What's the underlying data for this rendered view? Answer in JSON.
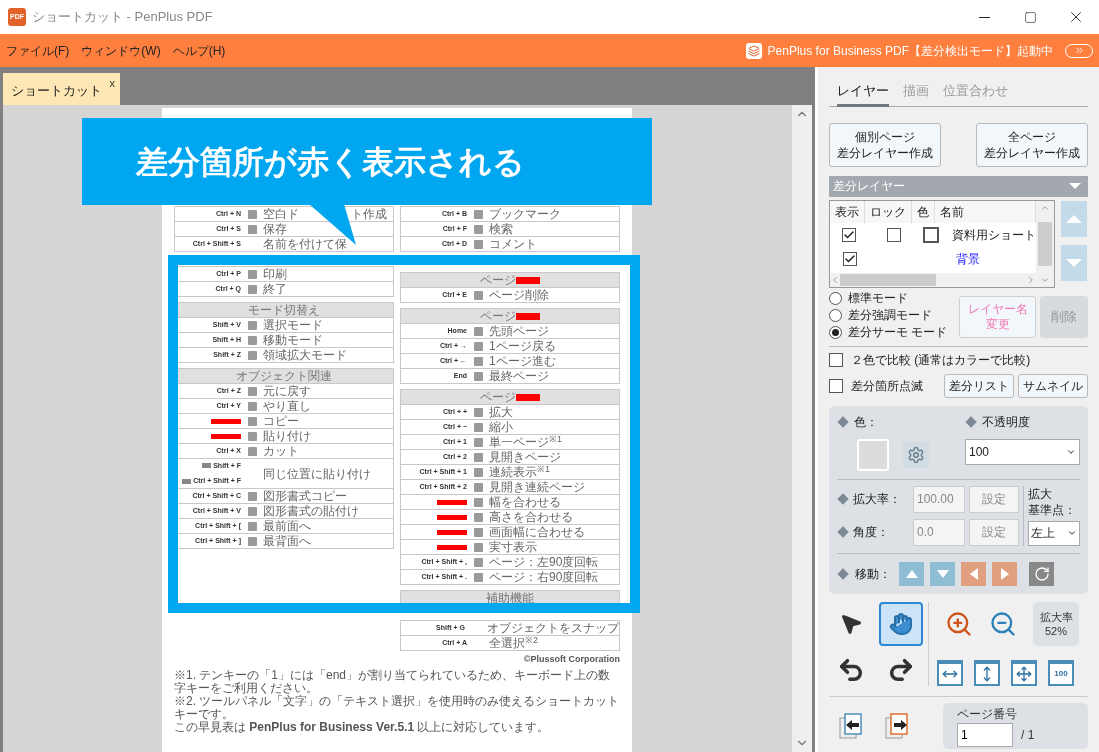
{
  "window": {
    "title": "ショートカット - PenPlus PDF",
    "app_icon_text": "PDF"
  },
  "menu": [
    "ファイル(F)",
    "ウィンドウ(W)",
    "ヘルプ(H)"
  ],
  "banner": {
    "text": "PenPlus for Business PDF【差分検出モード】起動中"
  },
  "doc_tabs": [
    {
      "label": "ショートカット",
      "close": "x",
      "selected": true
    }
  ],
  "callout": {
    "text": "差分箇所が赤く表示される"
  },
  "document": {
    "columns": [
      {
        "sections": [
          {
            "rows": [
              {
                "kind": "shortcut",
                "key": "Ctrl + N",
                "label": "空白ド",
                "label_rest": "ト作成",
                "icon": true
              },
              {
                "kind": "shortcut",
                "key": "Ctrl + S",
                "label": "保存",
                "icon": true
              },
              {
                "kind": "shortcut",
                "key": "Ctrl + Shift + S",
                "label": "名前を付けて保",
                "icon": false
              },
              {
                "kind": "covered"
              },
              {
                "kind": "shortcut",
                "key": "Ctrl + P",
                "label": "印刷",
                "icon": true
              },
              {
                "kind": "shortcut",
                "key": "Ctrl + Q",
                "label": "終了",
                "icon": true
              }
            ]
          },
          {
            "title": "モード切替え",
            "redacted_title": false,
            "rows": [
              {
                "kind": "shortcut",
                "key": "Shift + V",
                "label": "選択モード",
                "icon": true
              },
              {
                "kind": "shortcut",
                "key": "Shift + H",
                "label": "移動モード",
                "icon": true
              },
              {
                "kind": "shortcut",
                "key": "Shift + Z",
                "label": "領域拡大モード",
                "icon": true
              }
            ]
          },
          {
            "title": "オブジェクト関連",
            "redacted_title": false,
            "rows": [
              {
                "kind": "shortcut",
                "key": "Ctrl + Z",
                "label": "元に戻す",
                "icon": true
              },
              {
                "kind": "shortcut",
                "key": "Ctrl + Y",
                "label": "やり直し",
                "icon": true
              },
              {
                "kind": "redacted",
                "label": "コピー",
                "icon": true
              },
              {
                "kind": "redacted",
                "label": "貼り付け",
                "icon": true
              },
              {
                "kind": "shortcut",
                "key": "Ctrl + X",
                "label": "カット",
                "icon": true
              },
              {
                "kind": "double",
                "keys": [
                  "Shift + F",
                  "Ctrl + Shift + F"
                ],
                "label": "同じ位置に貼り付け",
                "icon": false
              },
              {
                "kind": "shortcut",
                "key": "Ctrl + Shift + C",
                "label": "図形書式コピー",
                "icon": true
              },
              {
                "kind": "shortcut",
                "key": "Ctrl + Shift + V",
                "label": "図形書式の貼付け",
                "icon": true
              },
              {
                "kind": "shortcut",
                "key": "Ctrl + Shift + [",
                "label": "最前面へ",
                "icon": true
              },
              {
                "kind": "shortcut",
                "key": "Ctrl + Shift + ]",
                "label": "最背面へ",
                "icon": true
              }
            ]
          }
        ]
      },
      {
        "sections": [
          {
            "rows": [
              {
                "kind": "shortcut",
                "key": "Ctrl + B",
                "label": "ブックマーク",
                "icon": true
              },
              {
                "kind": "shortcut",
                "key": "Ctrl + F",
                "label": "検索",
                "icon": true
              },
              {
                "kind": "shortcut",
                "key": "Ctrl + D",
                "label": "コメント",
                "icon": true
              },
              {
                "kind": "covered"
              }
            ]
          },
          {
            "title": "ページ",
            "redacted_title": true,
            "rows": [
              {
                "kind": "shortcut",
                "key": "Ctrl + E",
                "label": "ページ削除",
                "icon": true
              }
            ]
          },
          {
            "title": "ページ",
            "redacted_title": true,
            "rows": [
              {
                "kind": "shortcut",
                "key": "Home",
                "label": "先頭ページ",
                "icon": true
              },
              {
                "kind": "shortcut",
                "key": "Ctrl + →",
                "label": "1ページ戻る",
                "icon": true
              },
              {
                "kind": "shortcut",
                "key": "Ctrl + ←",
                "label": "1ページ進む",
                "icon": true
              },
              {
                "kind": "shortcut",
                "key": "End",
                "label": "最終ページ",
                "icon": true
              }
            ]
          },
          {
            "title": "ページ",
            "redacted_title": true,
            "rows": [
              {
                "kind": "shortcut",
                "key": "Ctrl + +",
                "label": "拡大",
                "icon": true
              },
              {
                "kind": "shortcut",
                "key": "Ctrl + −",
                "label": "縮小",
                "icon": true
              },
              {
                "kind": "shortcut",
                "key": "Ctrl + 1",
                "label": "単一ページ$^{※1}$",
                "icon": true
              },
              {
                "kind": "shortcut",
                "key": "Ctrl + 2",
                "label": "見開きページ",
                "icon": true
              },
              {
                "kind": "shortcut",
                "key": "Ctrl + Shift + 1",
                "label": "連続表示$^{※1}$",
                "icon": true
              },
              {
                "kind": "shortcut",
                "key": "Ctrl + Shift + 2",
                "label": "見開き連続ページ",
                "icon": true
              },
              {
                "kind": "redacted",
                "label": "幅を合わせる",
                "icon": true
              },
              {
                "kind": "redacted",
                "label": "高さを合わせる",
                "icon": true
              },
              {
                "kind": "redacted",
                "label": "画面幅に合わせる",
                "icon": true
              },
              {
                "kind": "redacted",
                "label": "実寸表示",
                "icon": true
              },
              {
                "kind": "shortcut",
                "key": "Ctrl + Shift + ,",
                "label": "ページ：左90度回転",
                "icon": true
              },
              {
                "kind": "shortcut",
                "key": "Ctrl + Shift + .",
                "label": "ページ：右90度回転",
                "icon": true
              }
            ]
          },
          {
            "title": "補助機能",
            "redacted_title": false,
            "rows": [
              {
                "kind": "covered"
              },
              {
                "kind": "shortcut",
                "key": "Shift + G",
                "label": "オブジェクトをスナップ",
                "icon": false
              },
              {
                "kind": "shortcut",
                "key": "Ctrl + A",
                "label": "全選択$^{※2}$",
                "icon": false
              }
            ]
          }
        ]
      }
    ],
    "copyright": "©Plussoft Corporation",
    "footnotes": [
      "※1. テンキーの「1」には「end」が割り当てられているため、キーボード上の数字キーをご利用ください。",
      "※2. ツールパネル「文字」の「テキスト選択」を使用時のみ使えるショートカットキーです。",
      "この早見表は **PenPlus for Business Ver.5.1** 以上に対応しています。"
    ]
  },
  "panel": {
    "tabs": [
      {
        "label": "レイヤー",
        "selected": true
      },
      {
        "label": "描画",
        "selected": false
      },
      {
        "label": "位置合わせ",
        "selected": false
      }
    ],
    "create_buttons": [
      {
        "lines": [
          "個別ページ",
          "差分レイヤー作成"
        ]
      },
      {
        "lines": [
          "全ページ",
          "差分レイヤー作成"
        ]
      }
    ],
    "layer_dropdown": "差分レイヤー",
    "layer_table": {
      "columns": [
        "表示",
        "ロック",
        "色",
        "名前"
      ],
      "rows": [
        {
          "kind": "layer",
          "visible": true,
          "locked": false,
          "name": "資料用ショート"
        },
        {
          "kind": "background",
          "visible": true,
          "name": "背景"
        }
      ]
    },
    "modes": [
      {
        "label": "標準モード",
        "selected": false
      },
      {
        "label": "差分強調モード",
        "selected": false
      },
      {
        "label": "差分サーモ モード",
        "selected": true
      }
    ],
    "rename_button": {
      "lines": [
        "レイヤー名",
        "変更"
      ]
    },
    "delete_button": {
      "label": "削除",
      "disabled": true
    },
    "options": [
      {
        "label": "２色で比較 (通常はカラーで比較)",
        "checked": false
      },
      {
        "label": "差分箇所点滅",
        "checked": false
      }
    ],
    "list_buttons": [
      "差分リスト",
      "サムネイル"
    ],
    "properties": {
      "color_label": "色：",
      "opacity_label": "不透明度",
      "opacity": "100",
      "scale_label": "拡大率：",
      "scale": "100.00",
      "angle_label": "角度：",
      "angle": "0.0",
      "set_buttons": [
        "設定",
        "設定"
      ],
      "anchor_label": [
        "拡大",
        "基準点："
      ],
      "anchor": "左上",
      "move_label": "移動："
    },
    "tools": [
      {
        "kind": "select",
        "selected": false
      },
      {
        "kind": "hand",
        "selected": true
      }
    ],
    "zoom_readout": {
      "label": "拡大率",
      "value": "52%"
    },
    "fit_actual_label": "100",
    "page": {
      "label": "ページ番号",
      "value": "1",
      "total": "/ 1"
    }
  }
}
